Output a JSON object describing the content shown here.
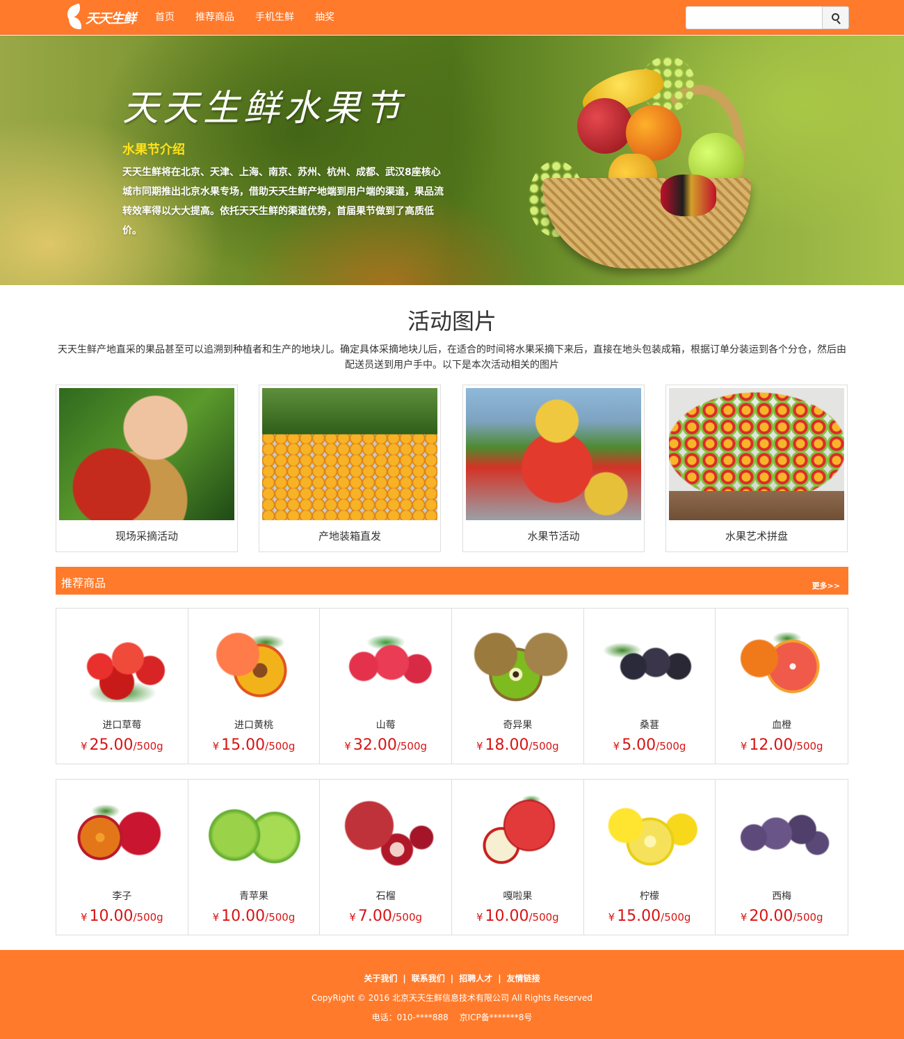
{
  "brand": {
    "name": "天天生鲜",
    "accent": "#ff7a2a",
    "price_color": "#d71414"
  },
  "nav": {
    "items": [
      {
        "label": "首页"
      },
      {
        "label": "推荐商品"
      },
      {
        "label": "手机生鲜"
      },
      {
        "label": "抽奖"
      }
    ],
    "search": {
      "value": "",
      "placeholder": "",
      "button_icon": "search-icon"
    }
  },
  "banner": {
    "title": "天天生鲜水果节",
    "subtitle": "水果节介绍",
    "description": "天天生鲜将在北京、天津、上海、南京、苏州、杭州、成都、武汉8座核心城市同期推出北京水果专场，借助天天生鲜产地端到用户端的渠道，果品流转效率得以大大提高。依托天天生鲜的渠道优势，首届果节做到了高质低价。"
  },
  "activity": {
    "title": "活动图片",
    "intro": "天天生鲜产地直采的果品甚至可以追溯到种植者和生产的地块儿。确定具体采摘地块儿后，在适合的时间将水果采摘下来后，直接在地头包装成箱，根据订单分装运到各个分仓，然后由配送员送到用户手中。以下是本次活动相关的图片",
    "items": [
      {
        "caption": "现场采摘活动"
      },
      {
        "caption": "产地装箱直发"
      },
      {
        "caption": "水果节活动"
      },
      {
        "caption": "水果艺术拼盘"
      }
    ]
  },
  "recommend": {
    "title": "推荐商品",
    "more": "更多>>",
    "currency": "¥",
    "unit": "/500g",
    "products": [
      {
        "name": "进口草莓",
        "price": "25.00"
      },
      {
        "name": "进口黄桃",
        "price": "15.00"
      },
      {
        "name": "山莓",
        "price": "32.00"
      },
      {
        "name": "奇异果",
        "price": "18.00"
      },
      {
        "name": "桑葚",
        "price": "5.00"
      },
      {
        "name": "血橙",
        "price": "12.00"
      },
      {
        "name": "李子",
        "price": "10.00"
      },
      {
        "name": "青苹果",
        "price": "10.00"
      },
      {
        "name": "石榴",
        "price": "7.00"
      },
      {
        "name": "嘎啦果",
        "price": "10.00"
      },
      {
        "name": "柠檬",
        "price": "15.00"
      },
      {
        "name": "西梅",
        "price": "20.00"
      }
    ]
  },
  "footer": {
    "links": [
      {
        "label": "关于我们"
      },
      {
        "label": "联系我们"
      },
      {
        "label": "招聘人才"
      },
      {
        "label": "友情链接"
      }
    ],
    "separator": "|",
    "copyright": "CopyRight © 2016 北京天天生鲜信息技术有限公司 All Rights Reserved",
    "phone": "电话：010-****888",
    "icp": "京ICP备*******8号"
  }
}
